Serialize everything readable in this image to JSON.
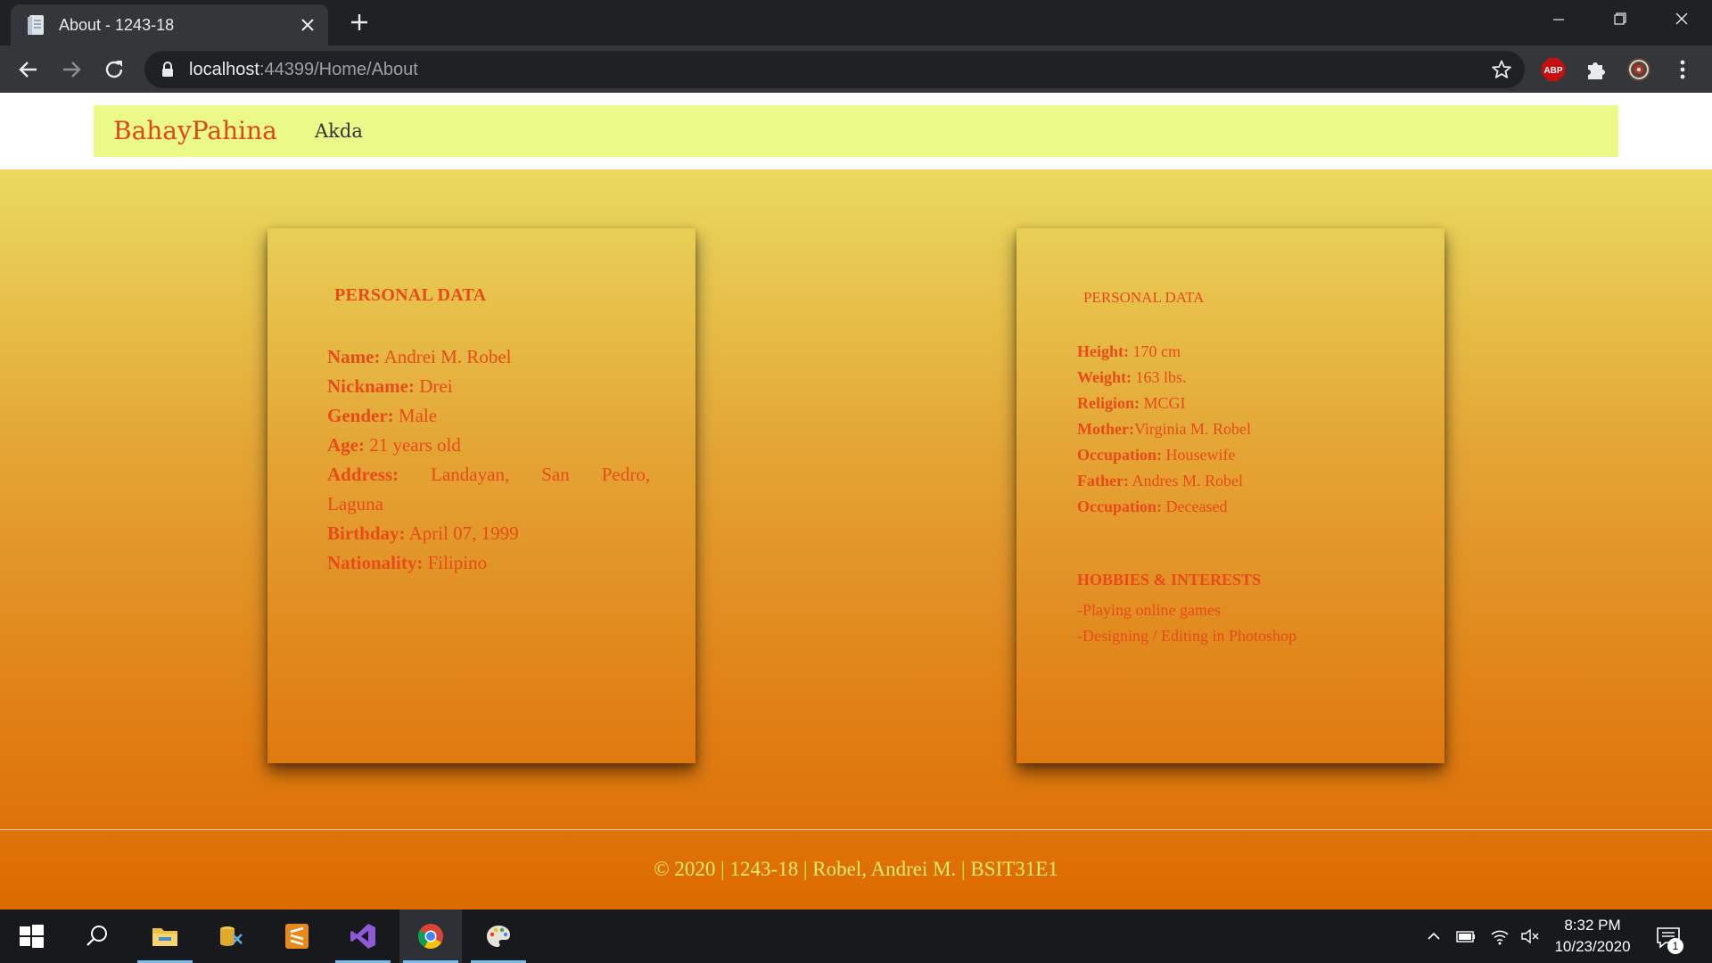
{
  "browser": {
    "tab_title": "About - 1243-18",
    "url_host": "localhost",
    "url_rest": ":44399/Home/About",
    "extensions": {
      "abp_label": "ABP"
    }
  },
  "site": {
    "brand": "BahayPahina",
    "nav": {
      "link": "Akda"
    }
  },
  "left_card": {
    "title": "PERSONAL DATA",
    "rows": [
      {
        "label": "Name:",
        "value": " Andrei M. Robel"
      },
      {
        "label": "Nickname:",
        "value": " Drei"
      },
      {
        "label": "Gender:",
        "value": " Male"
      },
      {
        "label": "Age:",
        "value": " 21 years old"
      },
      {
        "label": "Address:",
        "value": " Landayan, San Pedro,"
      },
      {
        "label": "",
        "value": "Laguna"
      },
      {
        "label": "Birthday:",
        "value": " April 07, 1999"
      },
      {
        "label": "Nationality:",
        "value": " Filipino"
      }
    ]
  },
  "right_card": {
    "title": "PERSONAL DATA",
    "rows": [
      {
        "label": "Height:",
        "value": " 170 cm"
      },
      {
        "label": "Weight:",
        "value": " 163 lbs."
      },
      {
        "label": "Religion:",
        "value": " MCGI"
      },
      {
        "label": "Mother:",
        "value": "Virginia M. Robel"
      },
      {
        "label": "Occupation:",
        "value": " Housewife"
      },
      {
        "label": "Father:",
        "value": " Andres M. Robel"
      },
      {
        "label": "Occupation:",
        "value": " Deceased"
      }
    ],
    "hobbies_title": "HOBBIES & INTERESTS",
    "hobbies": [
      "-Playing online games",
      "-Designing / Editing in Photoshop"
    ]
  },
  "footer": {
    "text": "© 2020 | 1243-18 | Robel, Andrei M. | BSIT31E1"
  },
  "taskbar": {
    "time": "8:32 PM",
    "date": "10/23/2020",
    "notification_count": "1"
  },
  "colors": {
    "accent_text": "#e84a1a",
    "navbar_bg": "#ebf988",
    "footer_text": "#f3ec6d"
  }
}
